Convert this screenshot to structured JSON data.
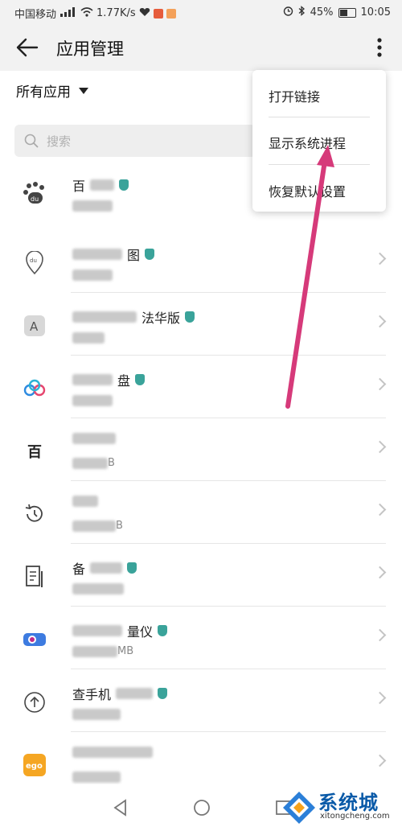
{
  "status_bar": {
    "carrier": "中国移动",
    "speed": "1.77K/s",
    "battery": "45%",
    "time": "10:05"
  },
  "header": {
    "title": "应用管理"
  },
  "filter": {
    "label": "所有应用"
  },
  "search": {
    "placeholder": "搜索"
  },
  "menu": {
    "items": [
      {
        "label": "打开链接"
      },
      {
        "label": "显示系统进程"
      },
      {
        "label": "恢复默认设置"
      }
    ]
  },
  "apps": [
    {
      "name": "百",
      "icon": "baidu-paw-icon",
      "size": ""
    },
    {
      "name": "图",
      "icon": "map-pin-icon",
      "size": ""
    },
    {
      "name": "法华版",
      "icon": "font-a-icon",
      "size": ""
    },
    {
      "name": "盘",
      "icon": "cloud-disk-icon",
      "size": ""
    },
    {
      "name": "",
      "icon": "baidu-app-icon",
      "size": "B"
    },
    {
      "name": "",
      "icon": "clock-history-icon",
      "size": "B"
    },
    {
      "name": "备",
      "icon": "document-icon",
      "size": ""
    },
    {
      "name": "量仪",
      "icon": "camera-lens-icon",
      "size": "MB"
    },
    {
      "name": "查手机",
      "icon": "upload-circle-icon",
      "size": ""
    },
    {
      "name": "",
      "icon": "ego-app-icon",
      "size": ""
    }
  ],
  "watermark": {
    "brand": "系统城",
    "url": "xitongcheng.com"
  },
  "colors": {
    "accent_arrow": "#d63a7a",
    "shield": "#3aa39a"
  }
}
